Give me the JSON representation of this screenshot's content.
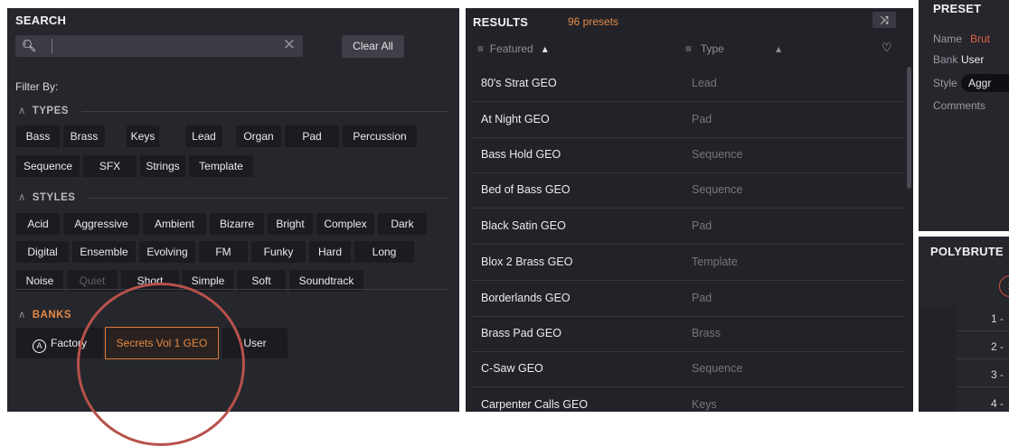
{
  "search": {
    "title": "SEARCH",
    "placeholder": "",
    "clear_all": "Clear All",
    "filter_by": "Filter By:",
    "types_label": "TYPES",
    "styles_label": "STYLES",
    "banks_label": "BANKS",
    "types": [
      "Bass",
      "Brass",
      "Keys",
      "Lead",
      "Organ",
      "Pad",
      "Percussion",
      "Sequence",
      "SFX",
      "Strings",
      "Template"
    ],
    "styles": [
      "Acid",
      "Aggressive",
      "Ambient",
      "Bizarre",
      "Bright",
      "Complex",
      "Dark",
      "Digital",
      "Ensemble",
      "Evolving",
      "FM",
      "Funky",
      "Hard",
      "Long",
      "Noise",
      "Quiet",
      "Short",
      "Simple",
      "Soft",
      "Soundtrack"
    ],
    "banks": [
      "Factory",
      "Secrets Vol 1 GEO",
      "User"
    ],
    "selected_bank": "Secrets Vol 1 GEO",
    "disabled_style": "Quiet"
  },
  "results": {
    "title": "RESULTS",
    "count": "96 presets",
    "col_featured": "Featured",
    "col_type": "Type",
    "rows": [
      {
        "name": "80's Strat GEO",
        "type": "Lead"
      },
      {
        "name": "At Night GEO",
        "type": "Pad"
      },
      {
        "name": "Bass Hold GEO",
        "type": "Sequence"
      },
      {
        "name": "Bed of Bass GEO",
        "type": "Sequence"
      },
      {
        "name": "Black Satin GEO",
        "type": "Pad"
      },
      {
        "name": "Blox 2 Brass GEO",
        "type": "Template"
      },
      {
        "name": "Borderlands GEO",
        "type": "Pad"
      },
      {
        "name": "Brass Pad GEO",
        "type": "Brass"
      },
      {
        "name": "C-Saw GEO",
        "type": "Sequence"
      },
      {
        "name": "Carpenter Calls GEO",
        "type": "Keys"
      }
    ]
  },
  "preset": {
    "title": "PRESET",
    "name_label": "Name",
    "name_value": "Brut",
    "bank_label": "Bank",
    "bank_value": "User",
    "style_label": "Style",
    "style_value": "Aggr",
    "comments_label": "Comments"
  },
  "polybrute": {
    "title": "POLYBRUTE",
    "circle_num": "1",
    "rows": [
      "1 -",
      "2 -",
      "3 -",
      "4 -"
    ]
  },
  "colors": {
    "accent": "#e58a45",
    "annotation": "#b6524a",
    "panel": "#26262d"
  },
  "icons": [
    "search-icon",
    "clear-icon",
    "shuffle-icon",
    "heart-icon",
    "sort-icon",
    "arturia-icon",
    "chevron-up-icon"
  ]
}
